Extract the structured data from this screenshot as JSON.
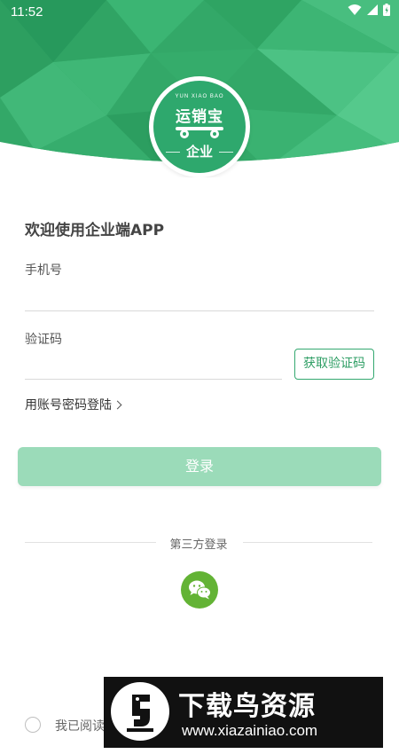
{
  "status_bar": {
    "time": "11:52"
  },
  "logo": {
    "latin": "YUN XIAO BAO",
    "brand": "运销宝",
    "badge": "企业"
  },
  "form": {
    "welcome": "欢迎使用企业端APP",
    "phone_label": "手机号",
    "phone_value": "",
    "code_label": "验证码",
    "code_value": "",
    "get_code": "获取验证码",
    "alt_login": "用账号密码登陆"
  },
  "login_button": "登录",
  "third_party": {
    "label": "第三方登录",
    "icon": "wechat-icon"
  },
  "agreement": {
    "text": "我已阅读"
  },
  "watermark": {
    "title": "下载鸟资源",
    "url": "www.xiazainiao.com"
  },
  "colors": {
    "brand_green": "#2ea86d",
    "button_disabled": "#9bdbb9",
    "wechat": "#63b335"
  }
}
